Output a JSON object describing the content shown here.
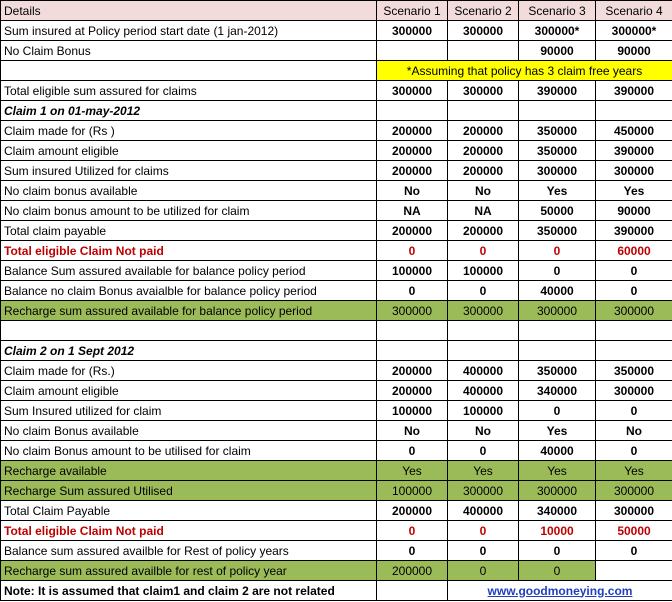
{
  "header": {
    "label": "Details",
    "scenarios": [
      "Scenario 1",
      "Scenario 2",
      "Scenario 3",
      "Scenario 4"
    ]
  },
  "rows": [
    {
      "label": "Sum insured at Policy period start date (1 jan-2012)",
      "values": [
        "300000",
        "300000",
        "300000*",
        "300000*"
      ],
      "style": "bold"
    },
    {
      "label": "No Claim Bonus",
      "values": [
        "",
        "",
        "90000",
        "90000"
      ],
      "style": "bold"
    },
    {
      "label": "",
      "note": "*Assuming that policy has 3 claim free years",
      "style": "note"
    },
    {
      "label": "Total eligible sum assured for claims",
      "values": [
        "300000",
        "300000",
        "390000",
        "390000"
      ],
      "style": "bold"
    },
    {
      "label": "Claim 1 on 01-may-2012",
      "values": [
        "",
        "",
        "",
        ""
      ],
      "style": "italic"
    },
    {
      "label": "Claim made for (Rs )",
      "values": [
        "200000",
        "200000",
        "350000",
        "450000"
      ],
      "style": "bold"
    },
    {
      "label": "Claim amount eligible",
      "values": [
        "200000",
        "200000",
        "350000",
        "390000"
      ],
      "style": "bold"
    },
    {
      "label": "Sum insured Utilized for claims",
      "values": [
        "200000",
        "200000",
        "300000",
        "300000"
      ],
      "style": "bold"
    },
    {
      "label": "No claim bonus available",
      "values": [
        "No",
        "No",
        "Yes",
        "Yes"
      ],
      "style": "bold"
    },
    {
      "label": "No claim bonus amount to be utilized for claim",
      "values": [
        "NA",
        "NA",
        "50000",
        "90000"
      ],
      "style": "bold"
    },
    {
      "label": "Total claim payable",
      "values": [
        "200000",
        "200000",
        "350000",
        "390000"
      ],
      "style": "bold"
    },
    {
      "label": "Total eligible Claim Not paid",
      "values": [
        "0",
        "0",
        "0",
        "60000"
      ],
      "style": "red"
    },
    {
      "label": "Balance Sum assured available for balance policy period",
      "values": [
        "100000",
        "100000",
        "0",
        "0"
      ],
      "style": "bold"
    },
    {
      "label": "Balance no claim Bonus avaialble for balance policy period",
      "values": [
        "0",
        "0",
        "40000",
        "0"
      ],
      "style": "bold"
    },
    {
      "label": "Recharge sum assured available for balance policy period",
      "values": [
        "300000",
        "300000",
        "300000",
        "300000"
      ],
      "style": "green"
    },
    {
      "label": "",
      "values": [
        "",
        "",
        "",
        ""
      ],
      "style": "blank"
    },
    {
      "label": "Claim 2 on 1 Sept 2012",
      "values": [
        "",
        "",
        "",
        ""
      ],
      "style": "italic"
    },
    {
      "label": "Claim made for (Rs.)",
      "values": [
        "200000",
        "400000",
        "350000",
        "350000"
      ],
      "style": "bold"
    },
    {
      "label": "Claim amount eligible",
      "values": [
        "200000",
        "400000",
        "340000",
        "300000"
      ],
      "style": "bold"
    },
    {
      "label": "Sum Insured utilized for claim",
      "values": [
        "100000",
        "100000",
        "0",
        "0"
      ],
      "style": "bold"
    },
    {
      "label": "No claim Bonus available",
      "values": [
        "No",
        "No",
        "Yes",
        "No"
      ],
      "style": "bold"
    },
    {
      "label": "No claim Bonus amount to be utilised for claim",
      "values": [
        "0",
        "0",
        "40000",
        "0"
      ],
      "style": "bold"
    },
    {
      "label": "Recharge available",
      "values": [
        "Yes",
        "Yes",
        "Yes",
        "Yes"
      ],
      "style": "green"
    },
    {
      "label": "Recharge Sum assured Utilised",
      "values": [
        "100000",
        "300000",
        "300000",
        "300000"
      ],
      "style": "green"
    },
    {
      "label": "Total Claim Payable",
      "values": [
        "200000",
        "400000",
        "340000",
        "300000"
      ],
      "style": "bold"
    },
    {
      "label": "Total eligible Claim Not paid",
      "values": [
        "0",
        "0",
        "10000",
        "50000"
      ],
      "style": "red"
    },
    {
      "label": "Balance sum assured availble for Rest of policy years",
      "values": [
        "0",
        "0",
        "0",
        "0"
      ],
      "style": "bold"
    },
    {
      "label": "Recharge sum assured availble for rest of policy year",
      "values": [
        "200000",
        "0",
        "0",
        ""
      ],
      "style": "green-partial"
    }
  ],
  "footer": {
    "note": "Note: It is assumed that claim1 and claim 2 are not related",
    "link": "www.goodmoneying.com"
  }
}
